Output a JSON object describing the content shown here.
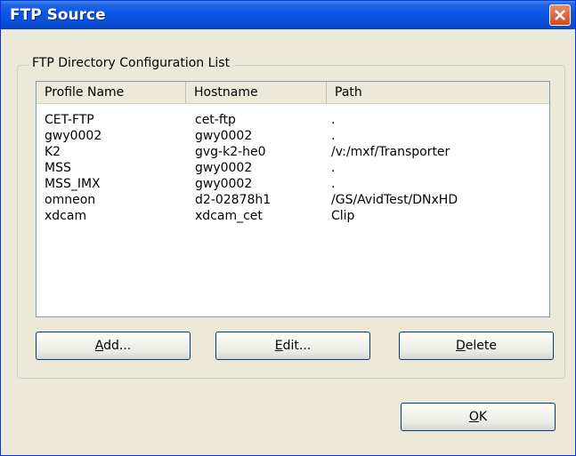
{
  "window": {
    "title": "FTP Source"
  },
  "group": {
    "label": "FTP Directory Configuration List"
  },
  "list": {
    "columns": [
      "Profile Name",
      "Hostname",
      "Path"
    ],
    "rows": [
      [
        "CET-FTP",
        "cet-ftp",
        "."
      ],
      [
        "gwy0002",
        "gwy0002",
        "."
      ],
      [
        "K2",
        "gvg-k2-he0",
        "/v:/mxf/Transporter"
      ],
      [
        "MSS",
        "gwy0002",
        "."
      ],
      [
        "MSS_IMX",
        "gwy0002",
        "."
      ],
      [
        "omneon",
        "d2-02878h1",
        "/GS/AvidTest/DNxHD"
      ],
      [
        "xdcam",
        "xdcam_cet",
        "Clip"
      ]
    ]
  },
  "buttons": {
    "add": {
      "pre": "",
      "mnemonic": "A",
      "post": "dd..."
    },
    "edit": {
      "pre": "",
      "mnemonic": "E",
      "post": "dit..."
    },
    "delete": {
      "pre": "",
      "mnemonic": "D",
      "post": "elete"
    },
    "ok": {
      "pre": "",
      "mnemonic": "O",
      "post": "K"
    }
  },
  "colors": {
    "title_bar": "#0a58e8",
    "close_button": "#d2481f",
    "dialog_bg": "#ece9d8"
  }
}
